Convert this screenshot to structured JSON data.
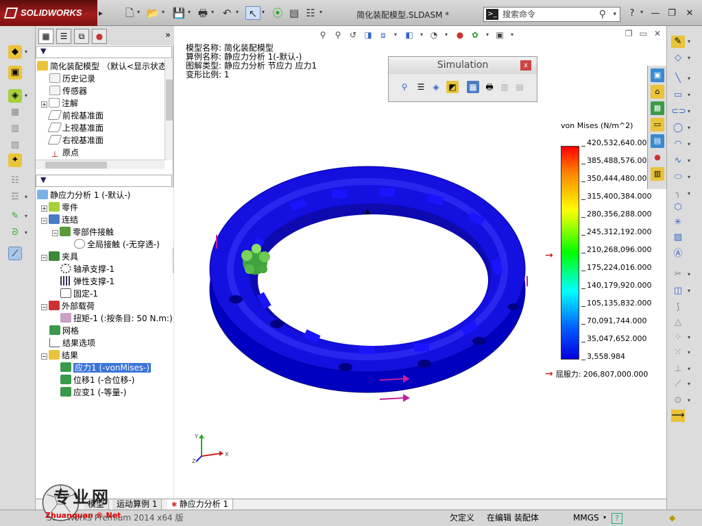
{
  "app": {
    "brand": "SOLIDWORKS",
    "doc_title": "简化装配模型.SLDASM *"
  },
  "search": {
    "placeholder": "搜索命令"
  },
  "feature_tree": {
    "assembly_label": "简化装配模型 （默认<显示状态",
    "items": [
      "历史记录",
      "传感器",
      "注解",
      "前视基准面",
      "上视基准面",
      "右视基准面",
      "原点"
    ]
  },
  "sim_tree": {
    "study": "静应力分析 1 (-默认-)",
    "parts": "零件",
    "connections": "连结",
    "component_contacts": "零部件接触",
    "global_contact": "全局接触 (-无穿透-)",
    "fixtures": "夹具",
    "bearing": "轴承支撑-1",
    "elastic": "弹性支撑-1",
    "fixed": "固定-1",
    "loads": "外部载荷",
    "torque": "扭矩-1 (:按条目: 50 N.m:)",
    "mesh": "网格",
    "result_options": "结果选项",
    "results": "结果",
    "stress": "应力1 (-vonMises-)",
    "displacement": "位移1 (-合位移-)",
    "strain": "应变1 (-等量-)"
  },
  "info": {
    "model": "模型名称: 简化装配模型",
    "config": "算例名称: 静应力分析 1(-默认-)",
    "plot_type": "图解类型: 静应力分析 节应力 应力1",
    "scale": "变形比例: 1"
  },
  "simulation_toolbar": {
    "title": "Simulation",
    "close": "x"
  },
  "legend": {
    "title": "von Mises (N/m^2)",
    "labels": [
      "420,532,640.000",
      "385,488,576.000",
      "350,444,480.000",
      "315,400,384.000",
      "280,356,288.000",
      "245,312,192.000",
      "210,268,096.000",
      "175,224,016.000",
      "140,179,920.000",
      "105,135,832.000",
      "70,091,744.000",
      "35,047,652.000",
      "3,558.984"
    ],
    "yield": "屈服力: 206,807,000.000",
    "colors": {
      "max": "#ff0000",
      "mid": "#00ff00",
      "min": "#0000dd"
    }
  },
  "triad": {
    "x": "X",
    "y": "Y",
    "z": "Z"
  },
  "tabs": {
    "model": "模型",
    "motion": "运动算例 1",
    "study": "静应力分析 1"
  },
  "status": {
    "edition": "SolidWorks Premium 2014 x64 版",
    "under_defined": "欠定义",
    "editing": "在编辑 装配体",
    "units": "MMGS",
    "help": "?"
  },
  "watermark": {
    "title": "专业网",
    "sub": "Zhuanquan ® Net"
  }
}
